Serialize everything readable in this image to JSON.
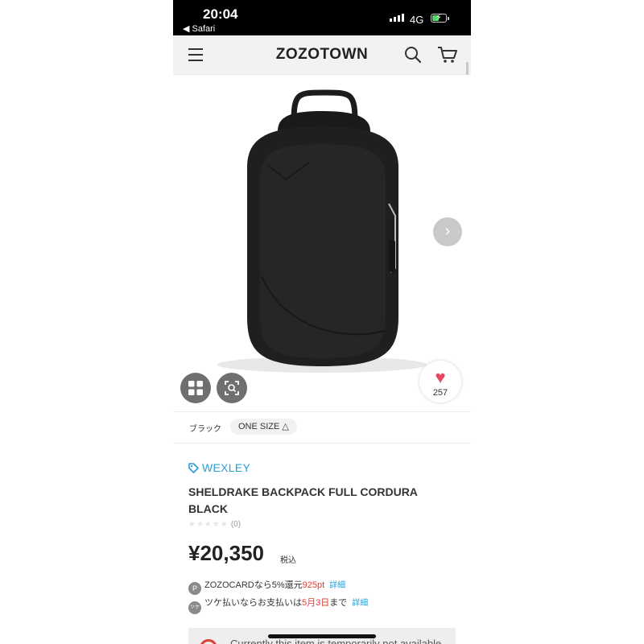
{
  "status_bar": {
    "time": "20:04",
    "back_label": "◀ Safari",
    "network": "4G"
  },
  "header": {
    "logo": "ZOZOTOWN",
    "icons": [
      "menu-icon",
      "search-icon",
      "cart-icon"
    ]
  },
  "gallery": {
    "next_icon": "chevron-right-icon",
    "favorite_count": "257"
  },
  "variant": {
    "color": "ブラック",
    "size": "ONE SIZE △"
  },
  "product": {
    "brand": "WEXLEY",
    "title": "SHELDRAKE BACKPACK FULL CORDURA BLACK",
    "rating_stars": "★★★★★",
    "review_count": "(0)",
    "price": "¥20,350",
    "tax_label": "税込"
  },
  "offers": {
    "card": {
      "icon_label": "P",
      "text": "ZOZOCARDなら5%還元",
      "points": "925pt",
      "link": "詳細"
    },
    "tsuke": {
      "icon_label": "ツケ",
      "text_before": "ツケ払いならお支払いは",
      "date": "5月3日",
      "text_after": "まで",
      "link": "詳細"
    }
  },
  "notice": {
    "text": "Currently this item is temporarily not available"
  },
  "colors": {
    "brand_blue": "#2a9fd6",
    "accent_red": "#e03c31",
    "heart_pink": "#e9475f"
  }
}
